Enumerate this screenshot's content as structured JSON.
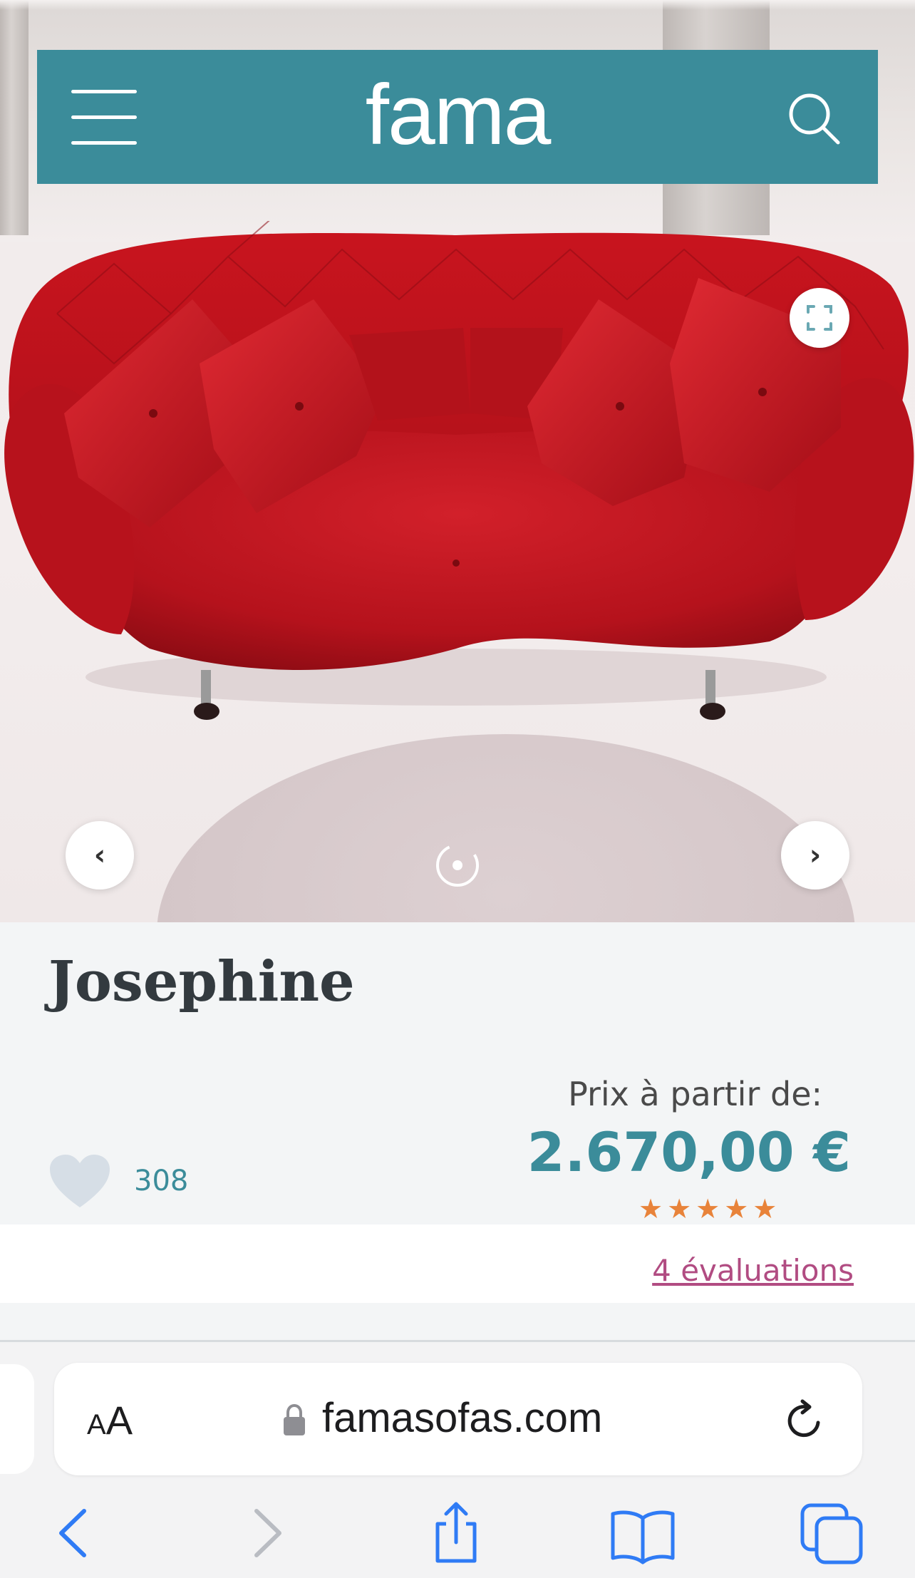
{
  "header": {
    "logo": "fama",
    "menu_icon": "hamburger-menu-icon",
    "search_icon": "search-icon",
    "background_color": "#3b8c9a"
  },
  "gallery": {
    "expand_icon": "expand-icon",
    "prev_label": "‹",
    "next_label": "›",
    "rotate_icon": "360-view-icon",
    "sofa_color": "#c8141e"
  },
  "product": {
    "name": "Josephine",
    "likes": "308",
    "price_label": "Prix à partir de:",
    "price": "2.670,00 €",
    "rating_stars": 5,
    "stars_text": "★★★★★",
    "reviews_link": "4 évaluations"
  },
  "browser": {
    "text_size_label": "A",
    "text_size_label_large": "A",
    "url": "famasofas.com",
    "toolbar": [
      "back-icon",
      "forward-icon",
      "share-icon",
      "bookmarks-icon",
      "tabs-icon"
    ]
  }
}
